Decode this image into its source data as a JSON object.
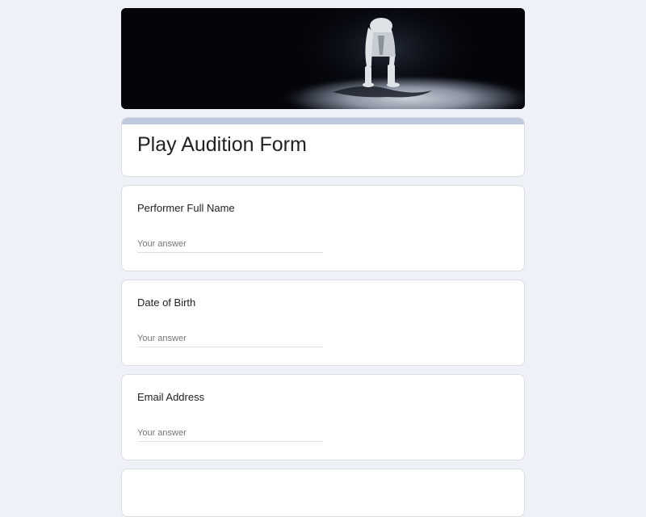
{
  "form": {
    "title": "Play Audition Form"
  },
  "questions": [
    {
      "label": "Performer Full Name",
      "placeholder": "Your answer"
    },
    {
      "label": "Date of Birth",
      "placeholder": "Your answer"
    },
    {
      "label": "Email Address",
      "placeholder": "Your answer"
    }
  ],
  "colors": {
    "page_background": "#eef2f8",
    "title_accent": "#c0cadf"
  },
  "banner": {
    "icon": "performer-spotlight-image"
  }
}
